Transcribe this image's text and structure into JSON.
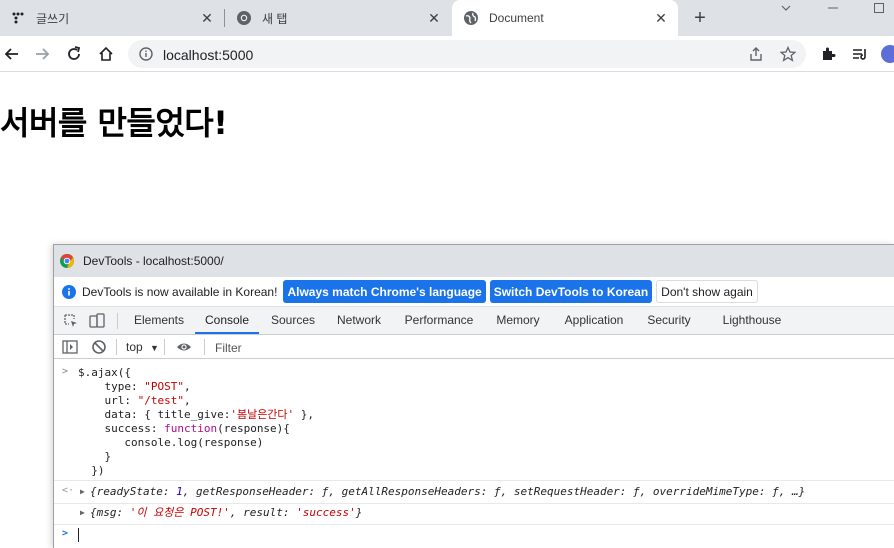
{
  "browser": {
    "tabs": [
      {
        "title": "글쓰기",
        "icon": "dots-logo-icon",
        "active": false
      },
      {
        "title": "새 탭",
        "icon": "chrome-icon",
        "active": false
      },
      {
        "title": "Document",
        "icon": "globe-icon",
        "active": true
      }
    ],
    "url": "localhost:5000"
  },
  "page": {
    "heading": "서버를 만들었다!"
  },
  "devtools": {
    "title": "DevTools - localhost:5000/",
    "infobar": {
      "message": "DevTools is now available in Korean!",
      "btn_match": "Always match Chrome's language",
      "btn_switch": "Switch DevTools to Korean",
      "btn_dismiss": "Don't show again"
    },
    "tabs": [
      "Elements",
      "Console",
      "Sources",
      "Network",
      "Performance",
      "Memory",
      "Application",
      "Security",
      "Lighthouse"
    ],
    "active_tab": "Console",
    "context": "top",
    "filter_placeholder": "Filter",
    "console": {
      "input_lines": [
        "$.ajax({",
        "    type: \"POST\",",
        "    url: \"/test\",",
        "    data: { title_give:'봄날은간다' },",
        "    success: function(response){",
        "       console.log(response)",
        "    }",
        "  })"
      ],
      "return_value": "{readyState: 1, getResponseHeader: ƒ, getAllResponseHeaders: ƒ, setRequestHeader: ƒ, overrideMimeType: ƒ, …}",
      "log_output": {
        "msg_key": "msg",
        "msg_value": "'이 요청은 POST!'",
        "result_key": "result",
        "result_value": "'success'"
      }
    }
  },
  "colors": {
    "accent": "#1a73e8",
    "string": "#c80000",
    "keyword": "#aa0d91"
  }
}
